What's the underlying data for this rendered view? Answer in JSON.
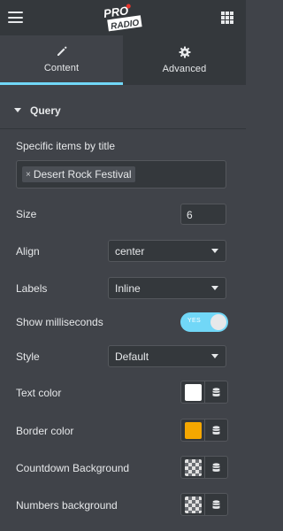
{
  "header": {
    "logo_text_top": "PRO",
    "logo_text_bottom": "RADIO",
    "menu_icon": "hamburger-icon",
    "apps_icon": "grid-icon"
  },
  "tabs": [
    {
      "label": "Content",
      "icon": "pencil-icon",
      "active": true
    },
    {
      "label": "Advanced",
      "icon": "gear-icon",
      "active": false
    }
  ],
  "section": {
    "title": "Query",
    "expanded": true
  },
  "fields": {
    "specific_items": {
      "label": "Specific items by title",
      "tags": [
        "Desert Rock Festival"
      ]
    },
    "size": {
      "label": "Size",
      "value": "6"
    },
    "align": {
      "label": "Align",
      "value": "center"
    },
    "labels": {
      "label": "Labels",
      "value": "Inline"
    },
    "show_ms": {
      "label": "Show milliseconds",
      "toggle_text": "YES",
      "on": true
    },
    "style": {
      "label": "Style",
      "value": "Default"
    },
    "text_color": {
      "label": "Text color",
      "color": "#ffffff"
    },
    "border_color": {
      "label": "Border color",
      "color": "#f5a700"
    },
    "countdown_bg": {
      "label": "Countdown Background",
      "color": "transparent"
    },
    "numbers_bg": {
      "label": "Numbers background",
      "color": "transparent"
    }
  },
  "colors": {
    "accent": "#71d7f7",
    "panel": "#404349",
    "topbar": "#34383c"
  }
}
